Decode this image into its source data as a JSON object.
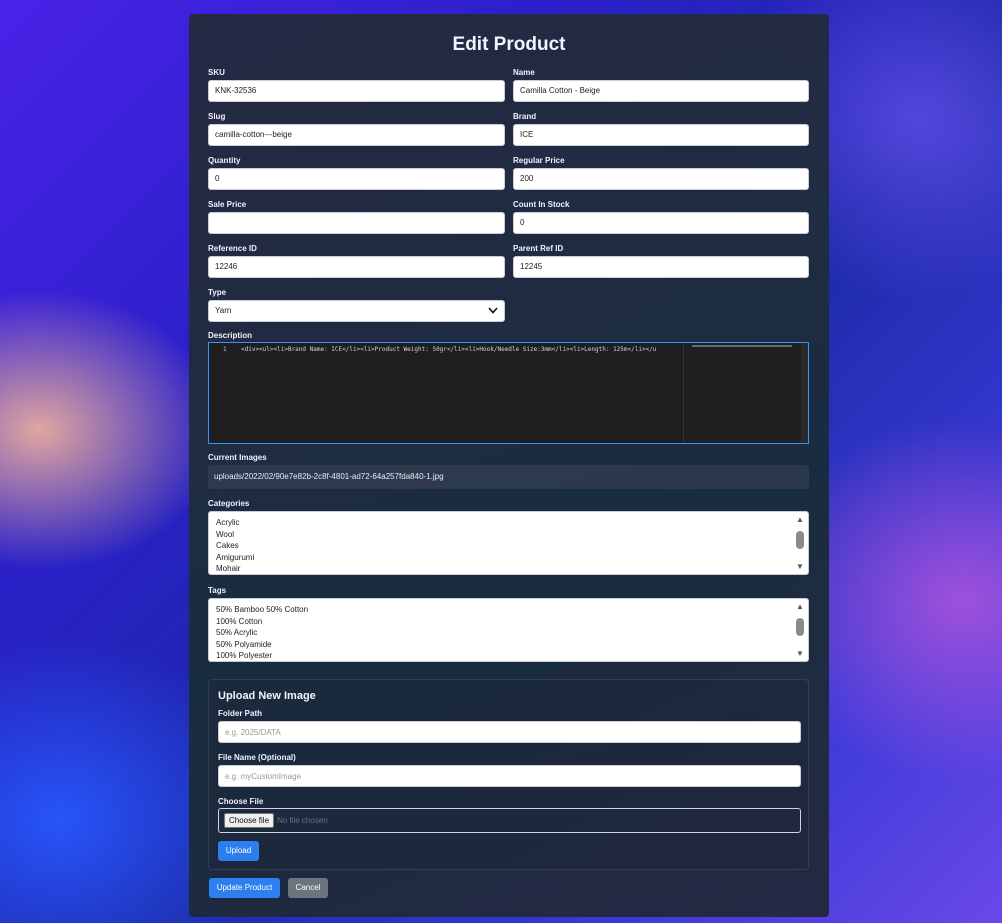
{
  "title": "Edit Product",
  "fields": {
    "sku": {
      "label": "SKU",
      "value": "KNK-32536"
    },
    "name": {
      "label": "Name",
      "value": "Camilla Cotton - Beige"
    },
    "slug": {
      "label": "Slug",
      "value": "camilla-cotton---beige"
    },
    "brand": {
      "label": "Brand",
      "value": "ICE"
    },
    "quantity": {
      "label": "Quantity",
      "value": "0"
    },
    "regular_price": {
      "label": "Regular Price",
      "value": "200"
    },
    "sale_price": {
      "label": "Sale Price",
      "value": ""
    },
    "count_in_stock": {
      "label": "Count In Stock",
      "value": "0"
    },
    "reference_id": {
      "label": "Reference ID",
      "value": "12246"
    },
    "parent_ref_id": {
      "label": "Parent Ref ID",
      "value": "12245"
    },
    "type": {
      "label": "Type",
      "value": "Yarn"
    }
  },
  "description": {
    "label": "Description",
    "line_number": "1",
    "code": "<div><ul><li>Brand Name: ICE</li><li>Product Weight: 50gr</li><li>Hook/Needle Size:3mm</li><li>Length: 125m</li></u"
  },
  "current_images": {
    "label": "Current Images",
    "path": "uploads/2022/02/90e7e82b-2c8f-4801-ad72-64a257fda840-1.jpg"
  },
  "categories": {
    "label": "Categories",
    "options": [
      "Acrylic",
      "Wool",
      "Cakes",
      "Amigurumi",
      "Mohair"
    ]
  },
  "tags": {
    "label": "Tags",
    "options": [
      "50% Bamboo 50% Cotton",
      "100% Cotton",
      "50% Acrylic",
      "50% Polyamide",
      "100% Polyester"
    ]
  },
  "upload": {
    "heading": "Upload New Image",
    "folder_label": "Folder Path",
    "folder_placeholder": "e.g. 2025/DATA",
    "filename_label": "File Name (Optional)",
    "filename_placeholder": "e.g. myCustomImage",
    "choose_label": "Choose File",
    "choose_button": "Choose file",
    "no_file": "No file chosen",
    "upload_button": "Upload"
  },
  "actions": {
    "update": "Update Product",
    "cancel": "Cancel"
  },
  "colors": {
    "primary": "#2d7ff0",
    "secondary": "#6c757d",
    "panel": "#242a3e"
  }
}
